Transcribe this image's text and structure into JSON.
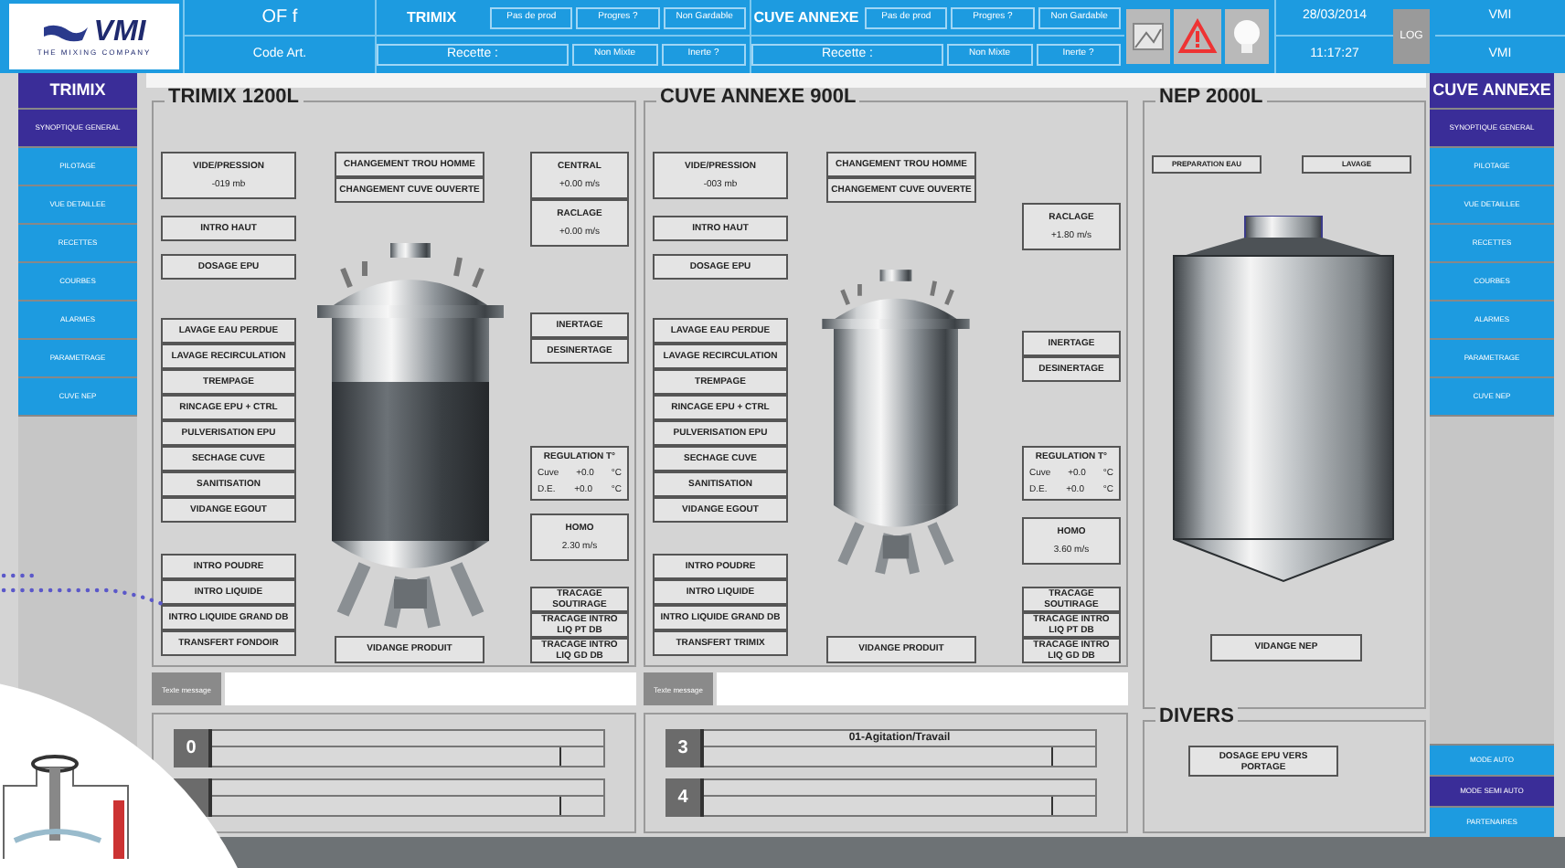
{
  "header": {
    "logo": {
      "name": "VMI",
      "tagline": "THE MIXING COMPANY"
    },
    "of": "OF f",
    "code_art": "Code Art.",
    "units": [
      {
        "name": "TRIMIX",
        "recipe": "Recette :",
        "buttons_top": [
          "Pas de prod",
          "Progres ?",
          "Non Gardable"
        ],
        "buttons_bottom": [
          "Non Mixte",
          "Inerte ?"
        ]
      },
      {
        "name": "CUVE ANNEXE",
        "recipe": "Recette :",
        "buttons_top": [
          "Pas de prod",
          "Progres ?",
          "Non Gardable"
        ],
        "buttons_bottom": [
          "Non Mixte",
          "Inerte ?"
        ]
      }
    ],
    "date": "28/03/2014",
    "time": "11:17:27",
    "log_button": "LOG",
    "user": [
      "VMI",
      "VMI"
    ]
  },
  "left_menu": {
    "title": "TRIMIX",
    "items": [
      {
        "label": "SYNOPTIQUE GENERAL",
        "selected": true
      },
      {
        "label": "PILOTAGE",
        "selected": false
      },
      {
        "label": "VUE DETAILLEE",
        "selected": false
      },
      {
        "label": "RECETTES",
        "selected": false
      },
      {
        "label": "COURBES",
        "selected": false
      },
      {
        "label": "ALARMES",
        "selected": false
      },
      {
        "label": "PARAMETRAGE",
        "selected": false
      },
      {
        "label": "CUVE NEP",
        "selected": false
      }
    ]
  },
  "right_menu": {
    "title": "CUVE ANNEXE",
    "items": [
      {
        "label": "SYNOPTIQUE GENERAL",
        "selected": true
      },
      {
        "label": "PILOTAGE",
        "selected": false
      },
      {
        "label": "VUE DETAILLEE",
        "selected": false
      },
      {
        "label": "RECETTES",
        "selected": false
      },
      {
        "label": "COURBES",
        "selected": false
      },
      {
        "label": "ALARMES",
        "selected": false
      },
      {
        "label": "PARAMETRAGE",
        "selected": false
      },
      {
        "label": "CUVE NEP",
        "selected": false
      }
    ],
    "mode_buttons": [
      {
        "label": "MODE AUTO",
        "selected": false
      },
      {
        "label": "MODE SEMI AUTO",
        "selected": true
      },
      {
        "label": "PARTENAIRES",
        "selected": false
      }
    ]
  },
  "tanks": [
    {
      "title": "TRIMIX 1200L",
      "band": true,
      "top_group": [
        {
          "label": "CHANGEMENT TROU HOMME"
        },
        {
          "label": "CHANGEMENT CUVE OUVERTE"
        }
      ],
      "left_groups": [
        [
          {
            "label": "VIDE/PRESSION",
            "value": "-019 mb"
          }
        ],
        [
          {
            "label": "INTRO HAUT"
          }
        ],
        [
          {
            "label": "DOSAGE EPU"
          }
        ],
        [
          {
            "label": "LAVAGE EAU PERDUE"
          },
          {
            "label": "LAVAGE RECIRCULATION"
          },
          {
            "label": "TREMPAGE"
          },
          {
            "label": "RINCAGE EPU + CTRL"
          },
          {
            "label": "PULVERISATION EPU"
          },
          {
            "label": "SECHAGE CUVE"
          },
          {
            "label": "SANITISATION"
          },
          {
            "label": "VIDANGE EGOUT"
          }
        ],
        [
          {
            "label": "INTRO POUDRE"
          },
          {
            "label": "INTRO LIQUIDE"
          },
          {
            "label": "INTRO LIQUIDE GRAND DB"
          },
          {
            "label": "TRANSFERT FONDOIR"
          }
        ]
      ],
      "right_groups": [
        [
          {
            "label": "CENTRAL",
            "value": "+0.00 m/s"
          },
          {
            "label": "RACLAGE",
            "value": "+0.00 m/s"
          }
        ],
        [
          {
            "label": "INERTAGE"
          },
          {
            "label": "DESINERTAGE"
          }
        ],
        [
          {
            "label": "REGULATION T°",
            "rows": [
              {
                "name": "Cuve",
                "value": "+0.0",
                "unit": "°C"
              },
              {
                "name": "D.E.",
                "value": "+0.0",
                "unit": "°C"
              }
            ]
          }
        ],
        [
          {
            "label": "HOMO",
            "value": "2.30 m/s"
          }
        ],
        [
          {
            "label": "TRACAGE SOUTIRAGE"
          },
          {
            "label": "TRACAGE INTRO LIQ PT DB"
          },
          {
            "label": "TRACAGE INTRO LIQ GD DB"
          }
        ]
      ],
      "bottom_button": "VIDANGE PRODUIT",
      "message_label": "Texte message",
      "steps": [
        {
          "number": "0",
          "level": 0.89
        },
        {
          "level": 0.89
        }
      ]
    },
    {
      "title": "CUVE ANNEXE 900L",
      "band": false,
      "top_group": [
        {
          "label": "CHANGEMENT TROU HOMME"
        },
        {
          "label": "CHANGEMENT CUVE OUVERTE"
        }
      ],
      "left_groups": [
        [
          {
            "label": "VIDE/PRESSION",
            "value": "-003 mb"
          }
        ],
        [
          {
            "label": "INTRO HAUT"
          }
        ],
        [
          {
            "label": "DOSAGE EPU"
          }
        ],
        [
          {
            "label": "LAVAGE EAU PERDUE"
          },
          {
            "label": "LAVAGE RECIRCULATION"
          },
          {
            "label": "TREMPAGE"
          },
          {
            "label": "RINCAGE EPU + CTRL"
          },
          {
            "label": "PULVERISATION EPU"
          },
          {
            "label": "SECHAGE CUVE"
          },
          {
            "label": "SANITISATION"
          },
          {
            "label": "VIDANGE EGOUT"
          }
        ],
        [
          {
            "label": "INTRO POUDRE"
          },
          {
            "label": "INTRO LIQUIDE"
          },
          {
            "label": "INTRO LIQUIDE GRAND DB"
          },
          {
            "label": "TRANSFERT TRIMIX"
          }
        ]
      ],
      "right_groups": [
        [
          {
            "label": "RACLAGE",
            "value": "+1.80 m/s"
          }
        ],
        [
          {
            "label": "INERTAGE"
          },
          {
            "label": "DESINERTAGE"
          }
        ],
        [
          {
            "label": "REGULATION T°",
            "rows": [
              {
                "name": "Cuve",
                "value": "+0.0",
                "unit": "°C"
              },
              {
                "name": "D.E.",
                "value": "+0.0",
                "unit": "°C"
              }
            ]
          }
        ],
        [
          {
            "label": "HOMO",
            "value": "3.60 m/s"
          }
        ],
        [
          {
            "label": "TRACAGE SOUTIRAGE"
          },
          {
            "label": "TRACAGE INTRO LIQ PT DB"
          },
          {
            "label": "TRACAGE INTRO LIQ GD DB"
          }
        ]
      ],
      "bottom_button": "VIDANGE PRODUIT",
      "message_label": "Texte message",
      "steps": [
        {
          "number": "3",
          "text": "01-Agitation/Travail",
          "level": 0.89
        },
        {
          "number": "4",
          "level": 0.89
        }
      ]
    }
  ],
  "nep": {
    "title": "NEP 2000L",
    "top_buttons": [
      "PREPARATION EAU",
      "LAVAGE"
    ],
    "bottom_button": "VIDANGE NEP"
  },
  "divers": {
    "title": "DIVERS",
    "button": "DOSAGE EPU VERS PORTAGE"
  }
}
